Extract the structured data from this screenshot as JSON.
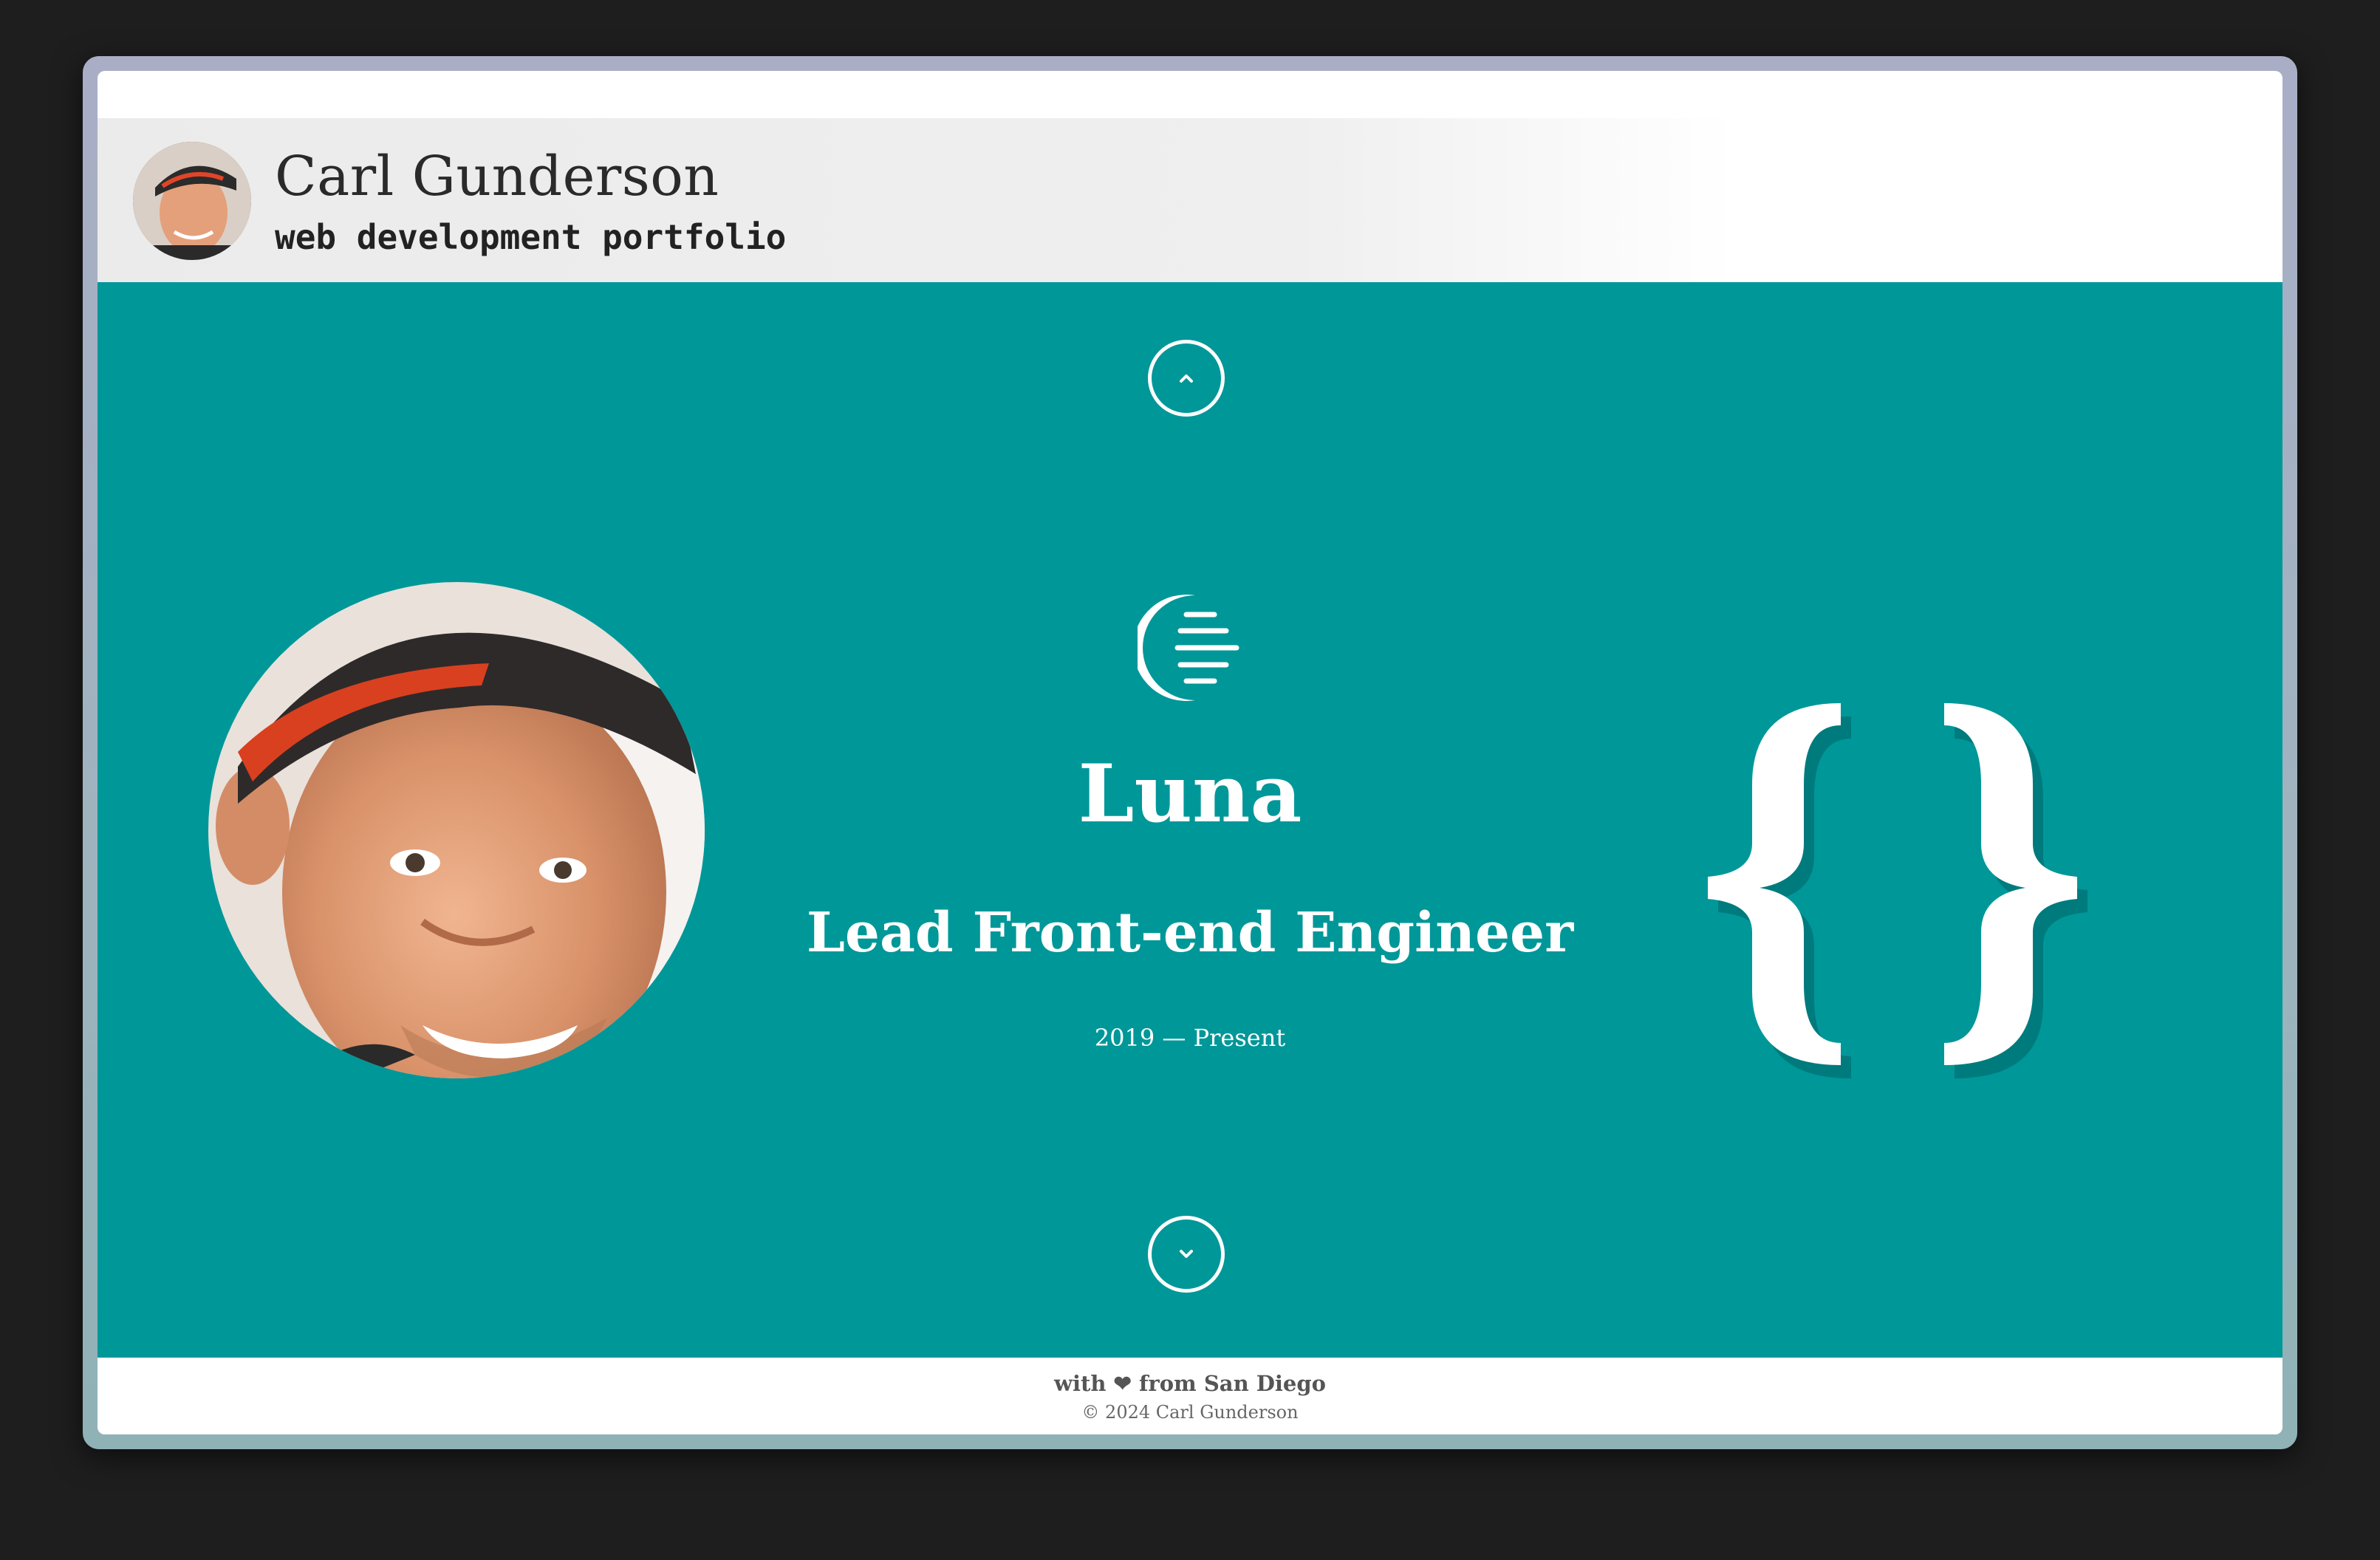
{
  "header": {
    "name": "Carl Gunderson",
    "subtitle": "web development portfolio"
  },
  "nav": {
    "up_icon": "chevron-up-icon",
    "down_icon": "chevron-down-icon"
  },
  "job": {
    "company": "Luna",
    "title": "Lead Front-end Engineer",
    "dates": "2019 — Present",
    "logo_icon": "luna-crescent-logo",
    "tech_icon": "curly-braces-icon"
  },
  "footer": {
    "tagline": "with ❤ from San Diego",
    "copyright": "© 2024 Carl Gunderson"
  },
  "colors": {
    "accent": "#009799",
    "background": "#1e1e1e",
    "header": "#eeeeee"
  }
}
